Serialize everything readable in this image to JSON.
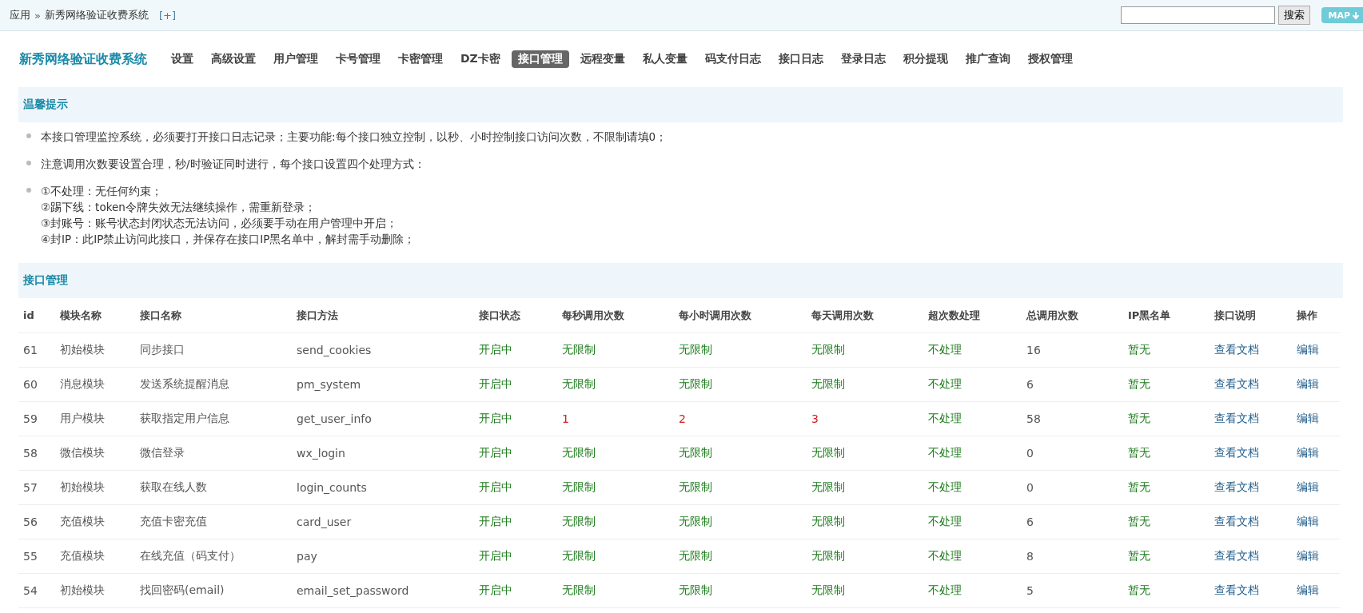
{
  "topbar": {
    "breadcrumb": [
      "应用",
      "新秀网络验证收费系统"
    ],
    "separator": "»",
    "add_link": "[+]",
    "search_button": "搜索",
    "map_button": "MAP"
  },
  "brand": "新秀网络验证收费系统",
  "nav": [
    {
      "label": "设置",
      "selected": false
    },
    {
      "label": "高级设置",
      "selected": false
    },
    {
      "label": "用户管理",
      "selected": false
    },
    {
      "label": "卡号管理",
      "selected": false
    },
    {
      "label": "卡密管理",
      "selected": false
    },
    {
      "label": "DZ卡密",
      "selected": false
    },
    {
      "label": "接口管理",
      "selected": true
    },
    {
      "label": "远程变量",
      "selected": false
    },
    {
      "label": "私人变量",
      "selected": false
    },
    {
      "label": "码支付日志",
      "selected": false
    },
    {
      "label": "接口日志",
      "selected": false
    },
    {
      "label": "登录日志",
      "selected": false
    },
    {
      "label": "积分提现",
      "selected": false
    },
    {
      "label": "推广查询",
      "selected": false
    },
    {
      "label": "授权管理",
      "selected": false
    }
  ],
  "tips": {
    "title": "温馨提示",
    "items": [
      [
        "本接口管理监控系统，必须要打开接口日志记录；主要功能:每个接口独立控制，以秒、小时控制接口访问次数，不限制请填0；"
      ],
      [
        "注意调用次数要设置合理，秒/时验证同时进行，每个接口设置四个处理方式："
      ],
      [
        "①不处理：无任何约束；",
        "②踢下线：token令牌失效无法继续操作，需重新登录；",
        "③封账号：账号状态封闭状态无法访问，必须要手动在用户管理中开启；",
        "④封IP：此IP禁止访问此接口，并保存在接口IP黑名单中，解封需手动删除；"
      ]
    ]
  },
  "table": {
    "title": "接口管理",
    "columns": [
      "id",
      "模块名称",
      "接口名称",
      "接口方法",
      "接口状态",
      "每秒调用次数",
      "每小时调用次数",
      "每天调用次数",
      "超次数处理",
      "总调用次数",
      "IP黑名单",
      "接口说明",
      "操作"
    ],
    "rows": [
      {
        "id": "61",
        "module": "初始模块",
        "name": "同步接口",
        "method": "send_cookies",
        "status": "开启中",
        "per_second": {
          "text": "无限制",
          "limited": false
        },
        "per_hour": {
          "text": "无限制",
          "limited": false
        },
        "per_day": {
          "text": "无限制",
          "limited": false
        },
        "overflow": "不处理",
        "total": "16",
        "blacklist": "暂无",
        "doc": "查看文档",
        "action": "编辑"
      },
      {
        "id": "60",
        "module": "消息模块",
        "name": "发送系统提醒消息",
        "method": "pm_system",
        "status": "开启中",
        "per_second": {
          "text": "无限制",
          "limited": false
        },
        "per_hour": {
          "text": "无限制",
          "limited": false
        },
        "per_day": {
          "text": "无限制",
          "limited": false
        },
        "overflow": "不处理",
        "total": "6",
        "blacklist": "暂无",
        "doc": "查看文档",
        "action": "编辑"
      },
      {
        "id": "59",
        "module": "用户模块",
        "name": "获取指定用户信息",
        "method": "get_user_info",
        "status": "开启中",
        "per_second": {
          "text": "1",
          "limited": true
        },
        "per_hour": {
          "text": "2",
          "limited": true
        },
        "per_day": {
          "text": "3",
          "limited": true
        },
        "overflow": "不处理",
        "total": "58",
        "blacklist": "暂无",
        "doc": "查看文档",
        "action": "编辑"
      },
      {
        "id": "58",
        "module": "微信模块",
        "name": "微信登录",
        "method": "wx_login",
        "status": "开启中",
        "per_second": {
          "text": "无限制",
          "limited": false
        },
        "per_hour": {
          "text": "无限制",
          "limited": false
        },
        "per_day": {
          "text": "无限制",
          "limited": false
        },
        "overflow": "不处理",
        "total": "0",
        "blacklist": "暂无",
        "doc": "查看文档",
        "action": "编辑"
      },
      {
        "id": "57",
        "module": "初始模块",
        "name": "获取在线人数",
        "method": "login_counts",
        "status": "开启中",
        "per_second": {
          "text": "无限制",
          "limited": false
        },
        "per_hour": {
          "text": "无限制",
          "limited": false
        },
        "per_day": {
          "text": "无限制",
          "limited": false
        },
        "overflow": "不处理",
        "total": "0",
        "blacklist": "暂无",
        "doc": "查看文档",
        "action": "编辑"
      },
      {
        "id": "56",
        "module": "充值模块",
        "name": "充值卡密充值",
        "method": "card_user",
        "status": "开启中",
        "per_second": {
          "text": "无限制",
          "limited": false
        },
        "per_hour": {
          "text": "无限制",
          "limited": false
        },
        "per_day": {
          "text": "无限制",
          "limited": false
        },
        "overflow": "不处理",
        "total": "6",
        "blacklist": "暂无",
        "doc": "查看文档",
        "action": "编辑"
      },
      {
        "id": "55",
        "module": "充值模块",
        "name": "在线充值（码支付）",
        "method": "pay",
        "status": "开启中",
        "per_second": {
          "text": "无限制",
          "limited": false
        },
        "per_hour": {
          "text": "无限制",
          "limited": false
        },
        "per_day": {
          "text": "无限制",
          "limited": false
        },
        "overflow": "不处理",
        "total": "8",
        "blacklist": "暂无",
        "doc": "查看文档",
        "action": "编辑"
      },
      {
        "id": "54",
        "module": "初始模块",
        "name": "找回密码(email)",
        "method": "email_set_password",
        "status": "开启中",
        "per_second": {
          "text": "无限制",
          "limited": false
        },
        "per_hour": {
          "text": "无限制",
          "limited": false
        },
        "per_day": {
          "text": "无限制",
          "limited": false
        },
        "overflow": "不处理",
        "total": "5",
        "blacklist": "暂无",
        "doc": "查看文档",
        "action": "编辑"
      }
    ]
  }
}
